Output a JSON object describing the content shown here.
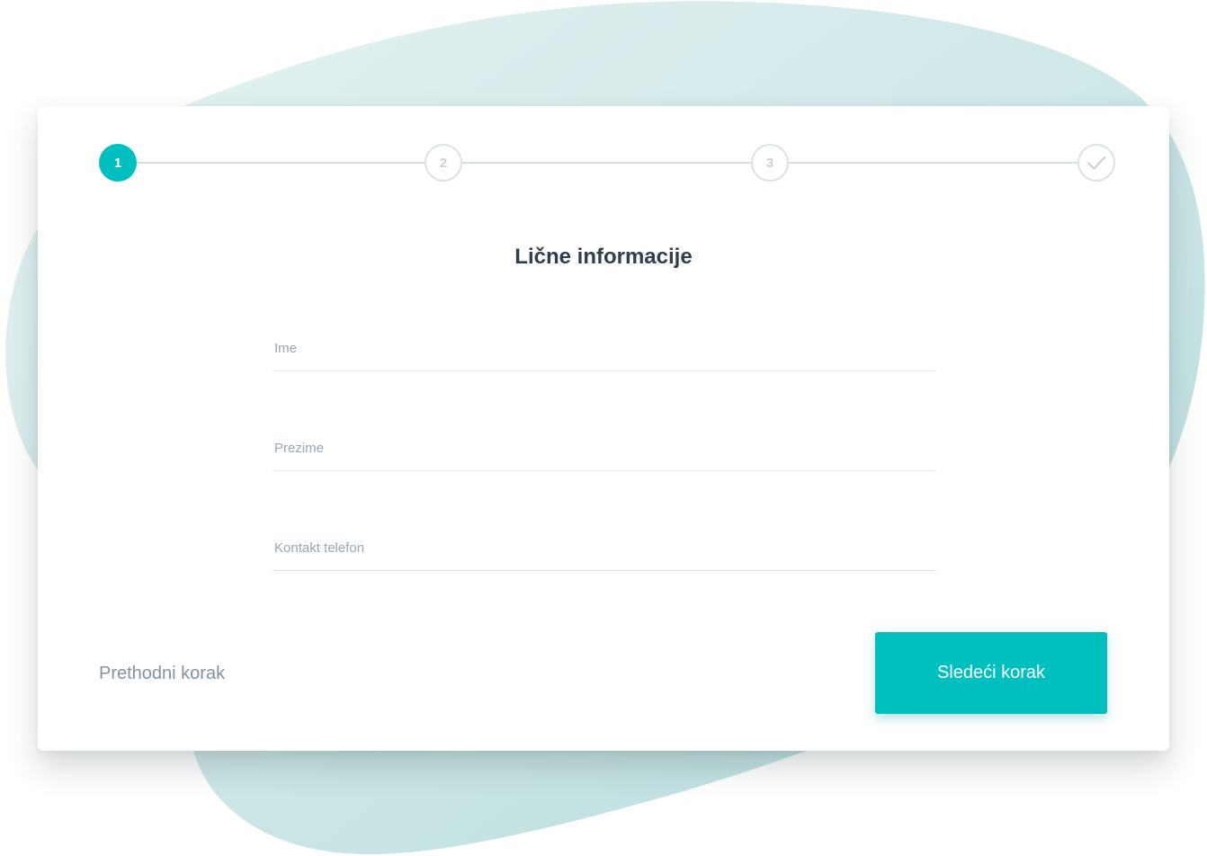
{
  "colors": {
    "accent": "#00bfbf",
    "title": "#2f3f4d",
    "muted": "#8393a3",
    "placeholder": "#9aa6b2",
    "step_inactive_border": "#dbe3e5",
    "blob": "#c4e2e3"
  },
  "stepper": {
    "current_step": 1,
    "steps": [
      {
        "label": "1",
        "state": "active"
      },
      {
        "label": "2",
        "state": "inactive"
      },
      {
        "label": "3",
        "state": "inactive"
      },
      {
        "label": "",
        "icon": "check-icon",
        "state": "inactive"
      }
    ]
  },
  "form": {
    "title": "Lične informacije",
    "fields": [
      {
        "placeholder": "Ime",
        "value": ""
      },
      {
        "placeholder": "Prezime",
        "value": ""
      },
      {
        "placeholder": "Kontakt telefon",
        "value": ""
      }
    ]
  },
  "actions": {
    "previous_label": "Prethodni korak",
    "next_label": "Sledeći korak"
  }
}
